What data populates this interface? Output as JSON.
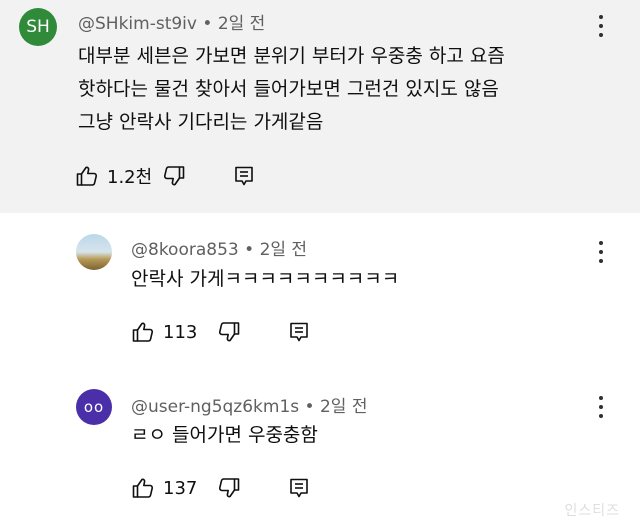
{
  "comments": [
    {
      "avatar_text": "SH",
      "handle": "@SHkim-st9iv",
      "separator": "•",
      "time": "2일 전",
      "lines": [
        "대부분 세븐은 가보면 분위기 부터가 우중충 하고 요즘",
        "핫하다는 물건 찾아서 들어가보면 그런건 있지도 않음",
        "그냥 안락사 기다리는 가게같음"
      ],
      "likes": "1.2천"
    },
    {
      "avatar_text": "",
      "handle": "@8koora853",
      "separator": "•",
      "time": "2일 전",
      "lines": [
        "안락사 가게ㅋㅋㅋㅋㅋㅋㅋㅋㅋㅋ"
      ],
      "likes": "113"
    },
    {
      "avatar_text": "oo",
      "handle": "@user-ng5qz6km1s",
      "separator": "•",
      "time": "2일 전",
      "lines": [
        "ㄹㅇ 들어가면 우중충함"
      ],
      "likes": "137"
    }
  ],
  "watermark": "인스티즈",
  "colors": {
    "top_comment_bg": "#f2f2f2",
    "avatar_sh": "#2f8a3a",
    "avatar_user": "#4a2fa8",
    "meta_text": "#606060"
  },
  "icons": [
    "thumbs-up-icon",
    "thumbs-down-icon",
    "reply-comment-icon",
    "more-vert-icon"
  ]
}
